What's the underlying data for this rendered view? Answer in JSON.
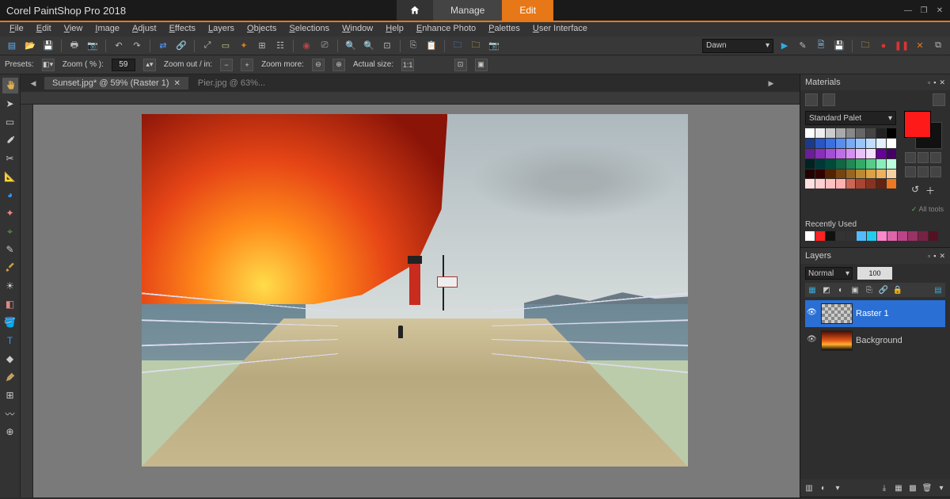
{
  "app": {
    "title": "Corel PaintShop Pro 2018"
  },
  "modes": {
    "home": "⌂",
    "manage": "Manage",
    "edit": "Edit",
    "active": "edit"
  },
  "menu": [
    "File",
    "Edit",
    "View",
    "Image",
    "Adjust",
    "Effects",
    "Layers",
    "Objects",
    "Selections",
    "Window",
    "Help",
    "Enhance Photo",
    "Palettes",
    "User Interface"
  ],
  "optionsbar": {
    "presets_label": "Presets:",
    "zoom_label": "Zoom ( % ):",
    "zoom_value": "59",
    "zoomout_label": "Zoom out / in:",
    "zoommore_label": "Zoom more:",
    "actual_label": "Actual size:"
  },
  "preset_combo": "Dawn",
  "doc_tabs": [
    {
      "label": "Sunset.jpg* @ 59% (Raster 1)",
      "active": true
    },
    {
      "label": "Pier.jpg @ 63%...",
      "active": false
    }
  ],
  "materials": {
    "title": "Materials",
    "palette_label": "Standard Palet",
    "alltools_label": "All tools",
    "recent_label": "Recently Used",
    "fg": "#ff1a1a",
    "bg": "#111111",
    "swatches": [
      "#ffffff",
      "#eeeeee",
      "#cccccc",
      "#aaaaaa",
      "#888888",
      "#666666",
      "#444444",
      "#222222",
      "#000000",
      "#1b3a8a",
      "#2a55c4",
      "#3a70e0",
      "#5a8df0",
      "#7aaaf6",
      "#9ac5fb",
      "#c0ddff",
      "#e5f0ff",
      "#ffffff",
      "#6a1e9a",
      "#8a2ebc",
      "#a44ed6",
      "#c06ee8",
      "#d690f2",
      "#eac0fa",
      "#f5e0ff",
      "#660099",
      "#440066",
      "#002222",
      "#003838",
      "#004a3a",
      "#116644",
      "#228855",
      "#33aa66",
      "#55cc88",
      "#88eebb",
      "#bbffdd",
      "#220000",
      "#330000",
      "#552200",
      "#774411",
      "#996622",
      "#bb8833",
      "#dda044",
      "#f0b060",
      "#f5d0a0",
      "#ffe0e0",
      "#ffd0d0",
      "#ffc0c0",
      "#ffb0b0",
      "#cc6655",
      "#aa4433",
      "#883322",
      "#662211",
      "#ee7722"
    ],
    "recent_swatches": [
      "#ffffff",
      "#ff2222",
      "#111111",
      "#333333",
      "#333333",
      "#55bbff",
      "#22ccee",
      "#ff88cc",
      "#dd66aa",
      "#bb4488",
      "#993366",
      "#772244",
      "#551122"
    ]
  },
  "layers": {
    "title": "Layers",
    "blend_mode": "Normal",
    "opacity": "100",
    "rows": [
      {
        "name": "Raster 1",
        "active": true,
        "thumb": "checker"
      },
      {
        "name": "Background",
        "active": false,
        "thumb": "sunset"
      }
    ]
  }
}
